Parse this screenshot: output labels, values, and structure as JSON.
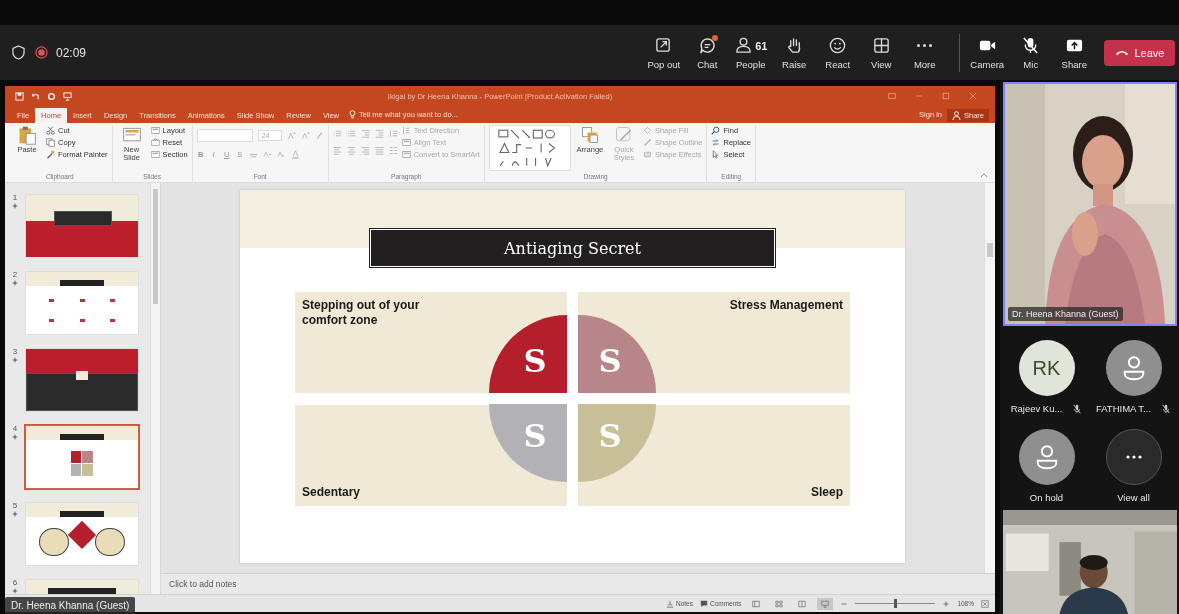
{
  "meeting_bar": {
    "recording": true,
    "timer": "02:09",
    "controls": [
      {
        "kind": "popout",
        "label": "Pop out"
      },
      {
        "kind": "chat",
        "label": "Chat",
        "unread": true
      },
      {
        "kind": "people",
        "label": "People",
        "count": "61"
      },
      {
        "kind": "raise",
        "label": "Raise"
      },
      {
        "kind": "react",
        "label": "React"
      },
      {
        "kind": "view",
        "label": "View"
      },
      {
        "kind": "more",
        "label": "More"
      },
      {
        "kind": "camera",
        "label": "Camera"
      },
      {
        "kind": "mic",
        "label": "Mic",
        "muted": true
      },
      {
        "kind": "share",
        "label": "Share"
      }
    ],
    "leave": "Leave"
  },
  "powerpoint": {
    "title": "Ikigai by Dr Heena Khanna - PowerPoint (Product Activation Failed)",
    "sign_in": "Sign in",
    "share": "Share",
    "tabs": [
      {
        "label": "File",
        "selected": false
      },
      {
        "label": "Home",
        "selected": true
      },
      {
        "label": "Insert",
        "selected": false
      },
      {
        "label": "Design",
        "selected": false
      },
      {
        "label": "Transitions",
        "selected": false
      },
      {
        "label": "Animations",
        "selected": false
      },
      {
        "label": "Slide Show",
        "selected": false
      },
      {
        "label": "Review",
        "selected": false
      },
      {
        "label": "View",
        "selected": false
      }
    ],
    "tell_me": "Tell me what you want to do...",
    "ribbon": [
      {
        "kind": "standard",
        "name": "Clipboard",
        "large": [
          {
            "label": "Paste",
            "disabled": false
          }
        ],
        "small": [
          {
            "label": "Cut",
            "disabled": false
          },
          {
            "label": "Copy",
            "disabled": false
          },
          {
            "label": "Format Painter",
            "disabled": false
          }
        ]
      },
      {
        "kind": "standard",
        "name": "Slides",
        "large": [
          {
            "label": "New Slide",
            "disabled": false
          }
        ],
        "small": [
          {
            "label": "Layout",
            "disabled": false
          },
          {
            "label": "Reset",
            "disabled": false
          },
          {
            "label": "Section",
            "disabled": false
          }
        ]
      },
      {
        "kind": "font",
        "name": "Font",
        "size": "24",
        "format": [
          "B",
          "I",
          "U",
          "S"
        ]
      },
      {
        "kind": "paragraph",
        "name": "Paragraph",
        "small": [
          {
            "label": "Text Direction",
            "disabled": true
          },
          {
            "label": "Align Text",
            "disabled": true
          },
          {
            "label": "Convert to SmartArt",
            "disabled": true
          }
        ]
      },
      {
        "kind": "drawing",
        "name": "Drawing",
        "large": [
          {
            "label": "Arrange",
            "disabled": false
          },
          {
            "label": "Quick Styles",
            "disabled": true
          }
        ],
        "small": [
          {
            "label": "Shape Fill",
            "disabled": true
          },
          {
            "label": "Shape Outline",
            "disabled": true
          },
          {
            "label": "Shape Effects",
            "disabled": true
          }
        ]
      },
      {
        "kind": "standard",
        "name": "Editing",
        "small": [
          {
            "label": "Find",
            "disabled": false
          },
          {
            "label": "Replace",
            "disabled": false
          },
          {
            "label": "Select",
            "disabled": false
          }
        ]
      }
    ],
    "thumbnails": [
      {
        "number": "1",
        "kind": "title",
        "selected": false
      },
      {
        "number": "2",
        "kind": "contents",
        "selected": false
      },
      {
        "number": "3",
        "kind": "section",
        "selected": false
      },
      {
        "number": "4",
        "kind": "quadrants",
        "selected": true
      },
      {
        "number": "5",
        "kind": "diagram",
        "selected": false
      },
      {
        "number": "6",
        "kind": "bar",
        "selected": false
      }
    ],
    "slide": {
      "title": "Antiaging Secret",
      "topics": [
        "Stepping out of your comfort zone",
        "Stress Management",
        "Sedentary",
        "Sleep"
      ],
      "segments": [
        {
          "letter": "S",
          "color": "#b51f2c"
        },
        {
          "letter": "S",
          "color": "#b8868a"
        },
        {
          "letter": "S",
          "color": "#b2b1b6"
        },
        {
          "letter": "S",
          "color": "#c8bf98"
        }
      ]
    },
    "notes_placeholder": "Click to add notes",
    "status": {
      "notes": "Notes",
      "comments": "Comments",
      "views": [
        {
          "kind": "normal",
          "selected": false
        },
        {
          "kind": "sorter",
          "selected": false
        },
        {
          "kind": "reading",
          "selected": false
        },
        {
          "kind": "slideshow",
          "selected": true
        }
      ],
      "zoom": "108%",
      "level": 0.5
    }
  },
  "presenter_label": "Dr. Heena Khanna (Guest)",
  "speaker": {
    "name": "Dr. Heena Khanna (Guest)",
    "speaking": true
  },
  "participants": [
    {
      "kind": "initials",
      "initials": "RK",
      "name": "Rajeev Ku...",
      "muted": true
    },
    {
      "kind": "avatar",
      "name": "FATHIMA T...",
      "muted": true
    },
    {
      "kind": "avatar",
      "name": "On hold",
      "muted": false
    },
    {
      "kind": "more",
      "name": "View all",
      "muted": false
    }
  ]
}
